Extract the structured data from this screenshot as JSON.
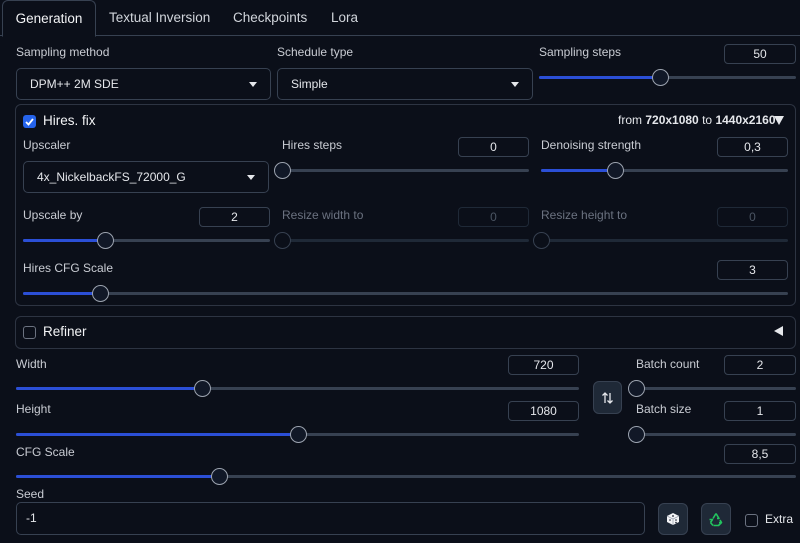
{
  "tabs": [
    "Generation",
    "Textual Inversion",
    "Checkpoints",
    "Lora"
  ],
  "sampling": {
    "method_label": "Sampling method",
    "method_value": "DPM++ 2M SDE",
    "schedule_label": "Schedule type",
    "schedule_value": "Simple",
    "steps_label": "Sampling steps",
    "steps_value": "50"
  },
  "hires": {
    "title": "Hires. fix",
    "from_prefix": "from",
    "from_value": "720x1080",
    "to_prefix": "to",
    "to_value": "1440x2160",
    "upscaler_label": "Upscaler",
    "upscaler_value": "4x_NickelbackFS_72000_G",
    "steps_label": "Hires steps",
    "steps_value": "0",
    "denoise_label": "Denoising strength",
    "denoise_value": "0,3",
    "upscale_label": "Upscale by",
    "upscale_value": "2",
    "width_label": "Resize width to",
    "width_value": "0",
    "height_label": "Resize height to",
    "height_value": "0",
    "cfg_label": "Hires CFG Scale",
    "cfg_value": "3"
  },
  "refiner": {
    "title": "Refiner"
  },
  "size": {
    "width_label": "Width",
    "width_value": "720",
    "height_label": "Height",
    "height_value": "1080",
    "batch_count_label": "Batch count",
    "batch_count_value": "2",
    "batch_size_label": "Batch size",
    "batch_size_value": "1",
    "cfg_label": "CFG Scale",
    "cfg_value": "8,5"
  },
  "seed": {
    "label": "Seed",
    "value": "-1",
    "extra_label": "Extra"
  },
  "sliders": {
    "sampling_steps": 0.47,
    "hires_steps": 0.0,
    "denoise": 0.3,
    "upscale_by": 0.33,
    "resize_width": 0.0,
    "resize_height": 0.0,
    "hires_cfg": 0.1,
    "width": 0.33,
    "height": 0.5,
    "batch_count": 0.0,
    "batch_size": 0.0,
    "cfg": 0.26
  },
  "colors": {
    "accent": "#2b4fd6",
    "background": "#0b0f19",
    "border": "#374151"
  }
}
